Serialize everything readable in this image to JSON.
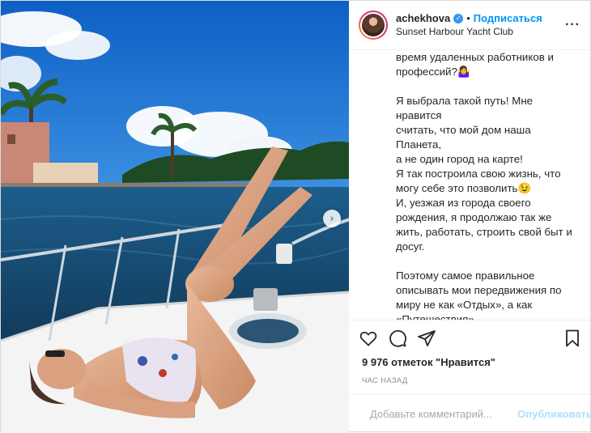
{
  "header": {
    "username": "achekhova",
    "separator": "•",
    "follow_label": "Подписаться",
    "location": "Sunset Harbour Yacht Club",
    "more_label": "···"
  },
  "caption": {
    "paragraphs": [
      "время удаленных работников и\nпрофессий?🤷‍♀️",
      "Я выбрала такой путь! Мне нравится\nсчитать, что мой дом наша Планета,\nа не один город на карте!\nЯ так построила свою жизнь, что\nмогу себе это позволить😉\nИ, уезжая из города своего\nрождения, я продолжаю так же\nжить, работать, строить свой быт и\nдосуг.",
      "Поэтому самое правильное\nописывать мои передвижения по\nмиру не как «Отдых», а как\n«Путешествия».\nЯ путешествую, а не приезжаю на\nотдых. И вся моя Жизнь -это\nбесконечное Путешествие!\nВозможно когда-нибудь я устану от"
    ]
  },
  "stats": {
    "likes_text": "9 976 отметок \"Нравится\"",
    "time_text": "час назад"
  },
  "comment": {
    "placeholder": "Добавьте комментарий...",
    "publish_label": "Опубликовать"
  },
  "icons": {
    "verified": "verified-badge-icon",
    "like": "heart-icon",
    "comment": "comment-icon",
    "share": "paper-plane-icon",
    "save": "bookmark-icon",
    "emoji": "smiley-icon",
    "next": "chevron-right-icon"
  },
  "colors": {
    "accent": "#0095f6",
    "publish_disabled": "#b2dffc",
    "muted": "#8e8e8e"
  }
}
